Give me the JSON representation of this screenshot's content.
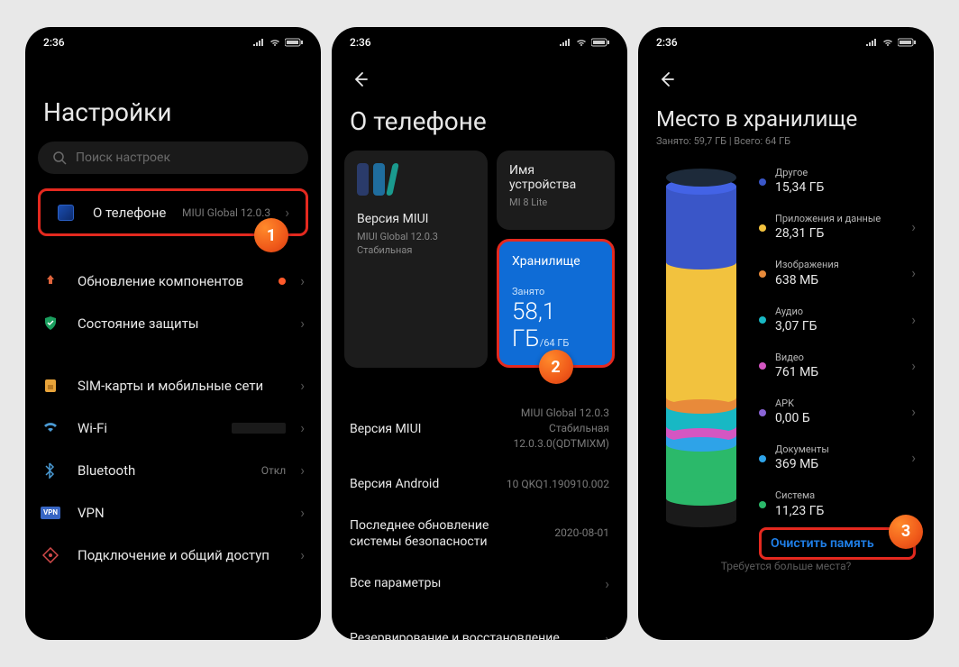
{
  "status": {
    "time": "2:36"
  },
  "screen1": {
    "title": "Настройки",
    "search_placeholder": "Поиск настроек",
    "about": {
      "label": "О телефоне",
      "value": "MIUI Global 12.0.3"
    },
    "update": "Обновление компонентов",
    "security": "Состояние защиты",
    "sim": "SIM-карты и мобильные сети",
    "wifi_label": "Wi-Fi",
    "wifi_value": "",
    "bt_label": "Bluetooth",
    "bt_value": "Откл",
    "vpn": "VPN",
    "share": "Подключение и общий доступ",
    "badge": "1"
  },
  "screen2": {
    "title": "О телефоне",
    "device_name_label": "Имя устройства",
    "device_name_value": "MI 8 Lite",
    "miui_label": "Версия MIUI",
    "miui_value": "MIUI Global 12.0.3 Стабильная",
    "storage_label": "Хранилище",
    "storage_used_label": "Занято",
    "storage_used": "58,1 ГБ",
    "storage_total": "/64 ГБ",
    "rows": {
      "miui": {
        "label": "Версия MIUI",
        "value": "MIUI Global 12.0.3\nСтабильная\n12.0.3.0(QDTMIXM)"
      },
      "android": {
        "label": "Версия Android",
        "value": "10 QKQ1.190910.002"
      },
      "patch": {
        "label": "Последнее обновление системы безопасности",
        "value": "2020-08-01"
      },
      "all": {
        "label": "Все параметры"
      },
      "backup": {
        "label": "Резервирование и восстановление"
      }
    },
    "badge": "2"
  },
  "screen3": {
    "title": "Место в хранилище",
    "subtitle": "Занято: 59,7 ГБ | Всего: 64 ГБ",
    "categories": [
      {
        "label": "Другое",
        "value": "15,34 ГБ",
        "color": "#3a56c8"
      },
      {
        "label": "Приложения и данные",
        "value": "28,31 ГБ",
        "color": "#f2c23e"
      },
      {
        "label": "Изображения",
        "value": "638 МБ",
        "color": "#e88a3a"
      },
      {
        "label": "Аудио",
        "value": "3,07 ГБ",
        "color": "#18b8c4"
      },
      {
        "label": "Видео",
        "value": "761 МБ",
        "color": "#d456c2"
      },
      {
        "label": "APK",
        "value": "0,00 Б",
        "color": "#8a64d6"
      },
      {
        "label": "Документы",
        "value": "369 МБ",
        "color": "#2ea3e8"
      },
      {
        "label": "Система",
        "value": "11,23 ГБ",
        "color": "#2bb96a"
      }
    ],
    "clean": "Очистить память",
    "hint": "Требуется больше места?",
    "badge": "3"
  }
}
